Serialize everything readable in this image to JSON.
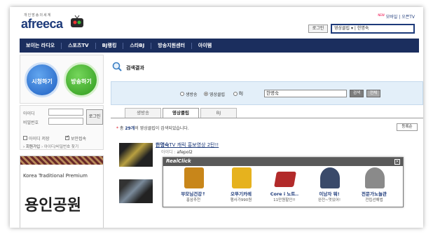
{
  "brand": {
    "tagline": "개인방송의세계",
    "logo_text": "afreeca"
  },
  "top_links": {
    "new_badge": "NEW",
    "mobile": "모바일",
    "separator": "|",
    "open_tv": "오픈TV"
  },
  "header": {
    "login_label": "로그인",
    "search_value": "영상클립 ▾ | 한명숙"
  },
  "nav": {
    "items": [
      "보이는 라디오",
      "스포츠TV",
      "BJ랭킹",
      "스타BJ",
      "방송지원센터",
      "아이템"
    ]
  },
  "left": {
    "watch_label": "시청하기",
    "broadcast_label": "방송하기",
    "id_label": "아이디",
    "pw_label": "비밀번호",
    "login_button": "로그인",
    "save_id_label": "아이디 저장",
    "secure_label": "보안접속",
    "join_label": "› 회원가입",
    "find_label": "› 아이디/비밀번호 찾기"
  },
  "ad": {
    "line1": "Korea Traditional Premium",
    "line2": "용인공원"
  },
  "search": {
    "heading": "검색결과",
    "options": [
      "생방송",
      "영상클립",
      "BJ"
    ],
    "selected_option": "영상클립",
    "query": "한명숙",
    "search_button": "검색",
    "detail_button": "전체"
  },
  "tabs": [
    "생방송",
    "영상클립",
    "BJ"
  ],
  "active_tab": "영상클립",
  "results": {
    "count_prefix": "총",
    "count": "29개",
    "count_suffix": "의 영상클립이 검색되었습니다.",
    "sort_label": "등록순",
    "items": [
      {
        "title_highlight": "한명숙",
        "title_rest": "TV 캐릭 홍보영상 2탄!!",
        "user_label": "아이디 :",
        "user_id": "afepol2"
      }
    ]
  },
  "realclick": {
    "logo": "RealClick",
    "close": "×",
    "items": [
      {
        "title": "부모님건강↑",
        "sub": "홍삼추천",
        "color": "#c8861a"
      },
      {
        "title": "오뚜기카레",
        "sub": "행사가990원",
        "color": "#e6b21e"
      },
      {
        "title": "Core i 노트..",
        "sub": "11만원할인!!",
        "color": "#b22a2a"
      },
      {
        "title": "이남자 뭐!",
        "sub": "완전~멋있어!",
        "color": "#3a4a6a"
      },
      {
        "title": "전문가노늘관",
        "sub": "전립선해법",
        "color": "#8a8a8a"
      }
    ]
  }
}
